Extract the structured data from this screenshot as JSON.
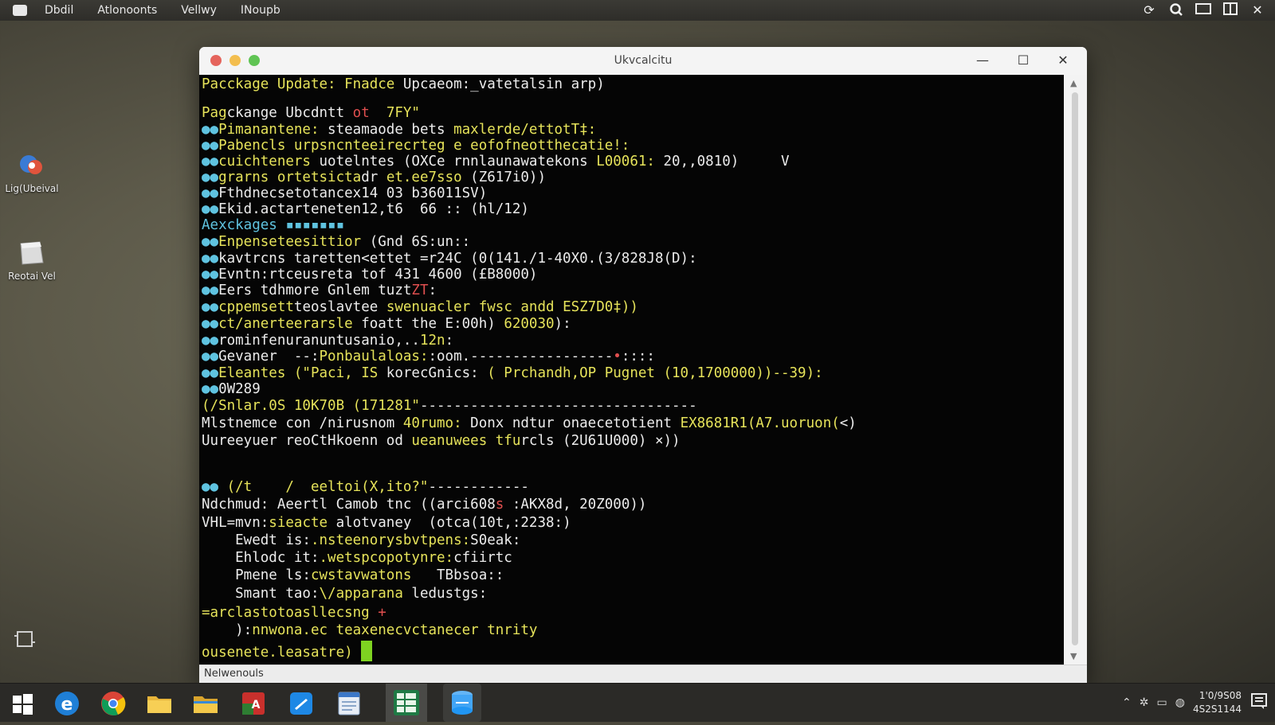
{
  "menubar": {
    "items": [
      "Dbdil",
      "Atlonoonts",
      "Vellwy",
      "INoupb"
    ]
  },
  "desktop": {
    "icons": [
      {
        "label": "Lig(Ubeival"
      },
      {
        "label": "Reotai Vel"
      }
    ]
  },
  "window": {
    "title": "Ukvcalcitu",
    "status_text": "Nelwenouls"
  },
  "terminal": {
    "lines": [
      [
        [
          "Pacckage Update: Fnadce ",
          "y"
        ],
        [
          "Upcaeom:_vatetalsin arp)",
          "w"
        ]
      ],
      [
        [
          "",
          "w"
        ]
      ],
      [
        [
          "Pag",
          "y"
        ],
        [
          "ckange Ubcdntt ",
          "w"
        ],
        [
          "ot  ",
          "r"
        ],
        [
          "7FY\"",
          "y"
        ]
      ],
      [
        [
          "●●",
          "c"
        ],
        [
          "Pimanantene: ",
          "y"
        ],
        [
          "steamaode bets ",
          "w"
        ],
        [
          "maxlerde/ettotT‡:",
          "y"
        ]
      ],
      [
        [
          "●●",
          "c"
        ],
        [
          "Pabencls urpsncnteeirecrteg e eofofneotthecatie!:",
          "y"
        ]
      ],
      [
        [
          "●●",
          "c"
        ],
        [
          "cuichteners ",
          "y"
        ],
        [
          "uotelntes (OXCe rnnlaunawatekons ",
          "w"
        ],
        [
          "L00061:",
          "y"
        ],
        [
          " 20,,0810)     V",
          "w"
        ]
      ],
      [
        [
          "●●",
          "c"
        ],
        [
          "grarns ortetsicta",
          "y"
        ],
        [
          "dr ",
          "w"
        ],
        [
          "et.ee7sso ",
          "y"
        ],
        [
          "(Z617i0))",
          "w"
        ]
      ],
      [
        [
          "●●",
          "c"
        ],
        [
          "Fthdnecsetotancex14 03 b36011SV)",
          "w"
        ]
      ],
      [
        [
          "●●",
          "c"
        ],
        [
          "Ekid.actarteneten12,t6  66 :: (hl/12)",
          "w"
        ]
      ],
      [
        [
          "Aexckages ",
          "c"
        ],
        [
          "▪▪▪▪▪▪▪",
          "c"
        ]
      ],
      [
        [
          "●●",
          "c"
        ],
        [
          "Enpenseteesittior ",
          "y"
        ],
        [
          "(Gnd 6S:un::",
          "w"
        ]
      ],
      [
        [
          "●●",
          "c"
        ],
        [
          "kavtrcns taretten<ettet =r24C (0(141./1-40X0.(3/828J8(D):",
          "w"
        ]
      ],
      [
        [
          "●●",
          "c"
        ],
        [
          "Evntn:rtceusreta tof 431 4600 (£B8000)",
          "w"
        ]
      ],
      [
        [
          "●●",
          "c"
        ],
        [
          "Eers tdhmore Gnlem tuzt",
          "w"
        ],
        [
          "ZT",
          "r"
        ],
        [
          ":",
          "w"
        ]
      ],
      [
        [
          "●●",
          "c"
        ],
        [
          "cppemsett",
          "y"
        ],
        [
          "teoslavtee ",
          "w"
        ],
        [
          "swenuacler fwsc andd",
          "y"
        ],
        [
          " ESZ7D0‡))",
          "y"
        ]
      ],
      [
        [
          "●●",
          "c"
        ],
        [
          "ct/anerteerarsle",
          "y"
        ],
        [
          " foatt the E:00h) ",
          "w"
        ],
        [
          "620030",
          "y"
        ],
        [
          "):",
          "w"
        ]
      ],
      [
        [
          "●●",
          "c"
        ],
        [
          "rominfenuranuntusanio,..",
          "w"
        ],
        [
          "12n",
          "y"
        ],
        [
          ":",
          "w"
        ]
      ],
      [
        [
          "●●",
          "c"
        ],
        [
          "Gevaner  --:",
          "w"
        ],
        [
          "Ponbaulaloas:",
          "y"
        ],
        [
          ":oom.-----------------",
          "w"
        ],
        [
          "•",
          "r"
        ],
        [
          "::::",
          "w"
        ]
      ],
      [
        [
          "●●",
          "c"
        ],
        [
          "Eleantes (\"Paci, IS ",
          "y"
        ],
        [
          "korecGnics: ",
          "w"
        ],
        [
          "( Prchandh,OP Pugnet (10,1700000))--39):",
          "y"
        ]
      ],
      [
        [
          "●●",
          "c"
        ],
        [
          "0W289",
          "w"
        ]
      ],
      [
        [
          "(/Snlar.0S 10K70B (171281\"",
          "y"
        ],
        [
          "---------------------------------",
          "w"
        ]
      ],
      [
        [
          "Mlstnemce con /nirusnom ",
          "w"
        ],
        [
          "40rumo: ",
          "y"
        ],
        [
          "Donx ndtur onaecetotient ",
          "w"
        ],
        [
          "EX8681R1(A7.uoruon(",
          "y"
        ],
        [
          "<)",
          "w"
        ]
      ],
      [
        [
          "Uureeyuer reoCtHkoenn od ",
          "w"
        ],
        [
          "ueanuwees tfu",
          "y"
        ],
        [
          "rcls (2U61U000) ×))",
          "w"
        ]
      ],
      [
        [
          "",
          "w"
        ]
      ],
      [
        [
          "●● ",
          "c"
        ],
        [
          "(/t    /  ",
          "y"
        ],
        [
          "eeltoi(X,ito?\"",
          "y"
        ],
        [
          "------------",
          "w"
        ]
      ],
      [
        [
          "Ndchmud: ",
          "w"
        ],
        [
          "Aeertl Camob tnc ((arci608",
          "w"
        ],
        [
          "s",
          "r"
        ],
        [
          " :AKX8d, 20Z000))",
          "w"
        ]
      ],
      [
        [
          "VHL=mvn:",
          "w"
        ],
        [
          "sieacte ",
          "y"
        ],
        [
          "alotvaney  (otca(10t,:2238:)",
          "w"
        ]
      ],
      [
        [
          "    Ewedt is:",
          "w"
        ],
        [
          ".nsteenorysbvtpens:",
          "y"
        ],
        [
          "S0eak:",
          "w"
        ]
      ],
      [
        [
          "    Ehlodc it:",
          "w"
        ],
        [
          ".wetspcopotynre:",
          "y"
        ],
        [
          "cfiirtc",
          "w"
        ]
      ],
      [
        [
          "    Pmene ls:",
          "w"
        ],
        [
          "cwstavwatons",
          "y"
        ],
        [
          "   TBbsoa::",
          "w"
        ]
      ],
      [
        [
          "    Smant tao:",
          "w"
        ],
        [
          "\\/apparana ",
          "y"
        ],
        [
          "ledustgs:",
          "w"
        ]
      ],
      [
        [
          "=arclastotoasllecsng ",
          "y"
        ],
        [
          "+",
          "r"
        ]
      ],
      [
        [
          "    ):",
          "w"
        ],
        [
          "nnwona.ec ",
          "y"
        ],
        [
          "teaxenecvctanecer tnrity",
          "y"
        ]
      ],
      [
        [
          "ousenete.leasatre) ",
          "y"
        ]
      ]
    ]
  },
  "tray": {
    "clock_time": "1'0/9S08",
    "clock_date": "4S2S1144"
  }
}
